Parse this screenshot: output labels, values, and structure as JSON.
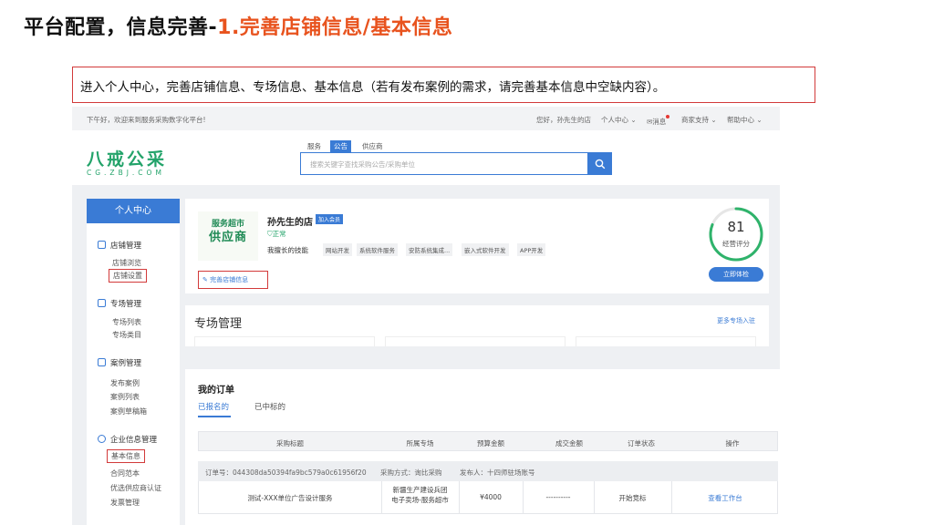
{
  "slide": {
    "title_prefix": "平台配置，信息完善-",
    "title_highlight": "1.完善店铺信息/基本信息",
    "note": "进入个人中心，完善店铺信息、专场信息、基本信息（若有发布案例的需求，请完善基本信息中空缺内容）。"
  },
  "topbar": {
    "welcome": "下午好，欢迎来到服务采购数字化平台!",
    "greeting": "您好，孙先生的店",
    "personal": "个人中心",
    "messages": "消息",
    "merchant": "商家支持",
    "help": "帮助中心"
  },
  "header": {
    "logo": "八戒公采",
    "logo_sub": "CG.ZBJ.COM",
    "search_tabs": [
      "服务",
      "公告",
      "供应商"
    ],
    "search_placeholder": "搜索关键字查找采购公告/采购单位"
  },
  "sidebar": {
    "title": "个人中心",
    "groups": [
      {
        "label": "店铺管理",
        "items": [
          "店铺浏览",
          "店铺设置"
        ]
      },
      {
        "label": "专场管理",
        "items": [
          "专场列表",
          "专场类目"
        ]
      },
      {
        "label": "案例管理",
        "items": [
          "发布案例",
          "案例列表",
          "案例草稿箱"
        ]
      },
      {
        "label": "企业信息管理",
        "items": [
          "基本信息",
          "合同范本",
          "优选供应商认证",
          "发票管理"
        ]
      }
    ]
  },
  "shop": {
    "logo_line1": "服务超市",
    "logo_line2": "供应商",
    "name": "孙先生的店",
    "badge": "加入会员",
    "status": "正常",
    "skills_label": "我擅长的技能",
    "skills": [
      "网站开发",
      "系统软件服务",
      "安防系统集成...",
      "嵌入式软件开发",
      "APP开发"
    ],
    "edit_link": "完善店铺信息",
    "score": "81",
    "score_label": "经营评分",
    "check_button": "立即体检"
  },
  "zone": {
    "title": "专场管理",
    "more": "更多专场入驻"
  },
  "orders": {
    "title": "我的订单",
    "tabs": [
      "已报名的",
      "已中标的"
    ],
    "headers": [
      "采购标题",
      "所属专场",
      "预算金额",
      "成交金额",
      "订单状态",
      "操作"
    ],
    "info": {
      "order_no": "订单号：044308da50394fa9bc579a0c61956f20",
      "method": "采购方式：询比采购",
      "publisher": "发布人：十四师驻场账号"
    },
    "row": {
      "title": "测试-XXX单位广告设计服务",
      "zone_line1": "新疆生产建设兵团",
      "zone_line2": "电子卖场-服务超市",
      "budget": "¥4000",
      "deal": "----------",
      "status": "开始竞标",
      "action": "查看工作台"
    }
  }
}
